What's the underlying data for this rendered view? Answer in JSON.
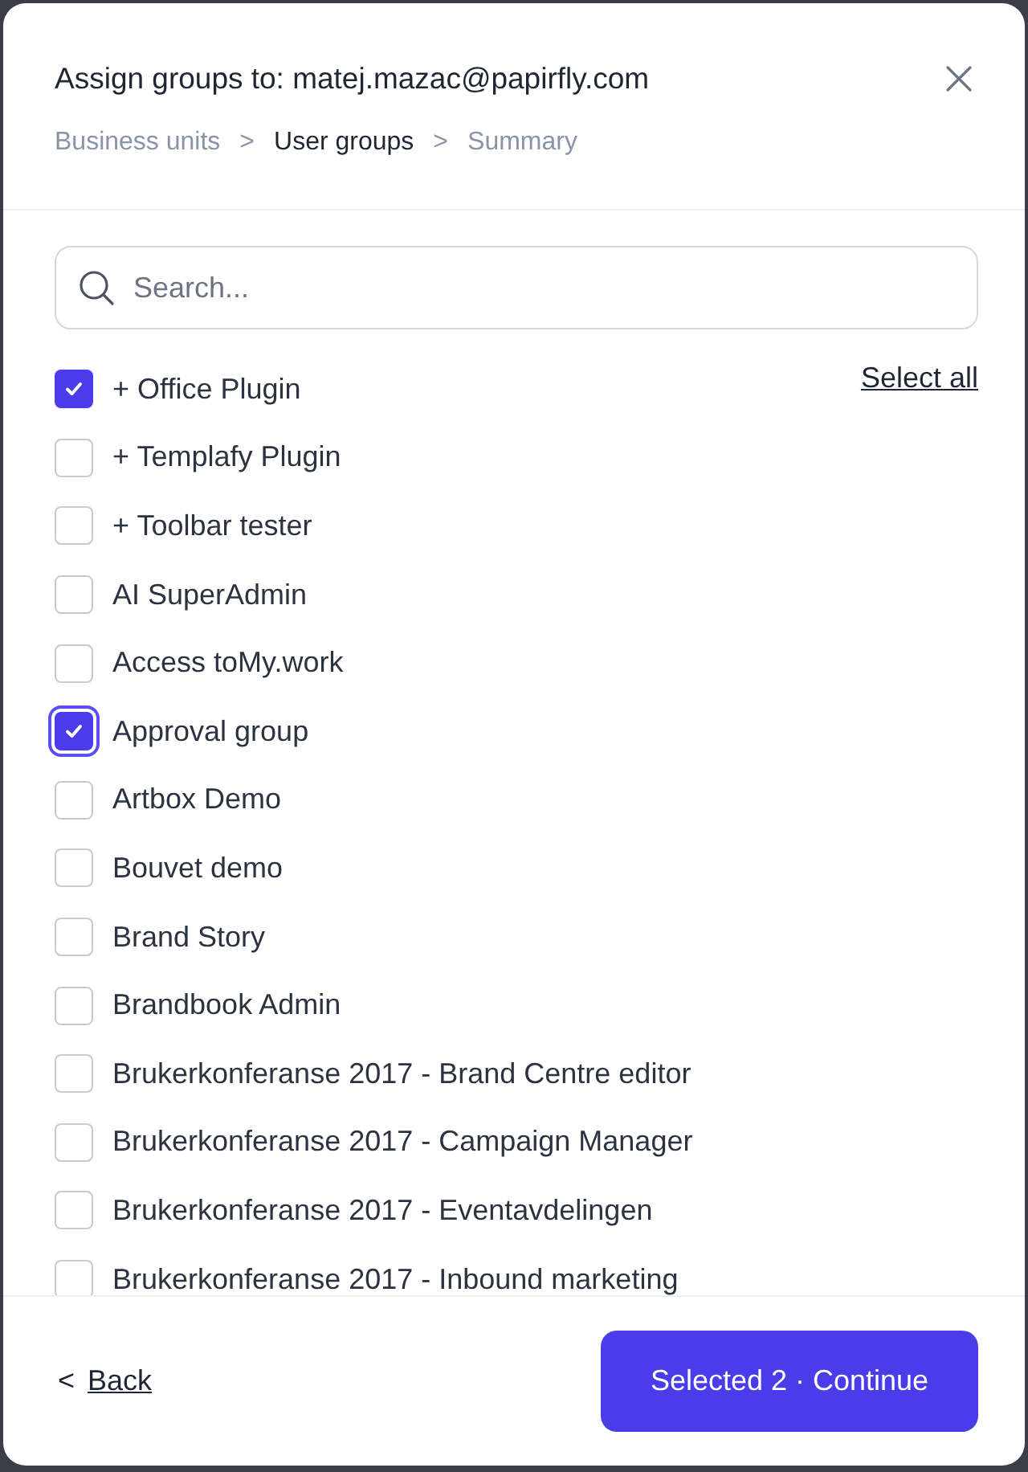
{
  "dialog": {
    "title": "Assign groups to: matej.mazac@papirfly.com",
    "breadcrumb": [
      {
        "label": "Business units",
        "selected": false
      },
      {
        "label": "User groups",
        "selected": true
      },
      {
        "label": "Summary",
        "selected": false
      }
    ],
    "breadcrumb_separator": ">",
    "search": {
      "placeholder": "Search..."
    },
    "select_all": "Select all",
    "groups": [
      {
        "label": "+ Office Plugin",
        "checked": true,
        "focused": false
      },
      {
        "label": "+ Templafy Plugin",
        "checked": false,
        "focused": false
      },
      {
        "label": "+ Toolbar tester",
        "checked": false,
        "focused": false
      },
      {
        "label": "AI SuperAdmin",
        "checked": false,
        "focused": false
      },
      {
        "label": "Access toMy.work",
        "checked": false,
        "focused": false
      },
      {
        "label": "Approval group",
        "checked": true,
        "focused": true
      },
      {
        "label": "Artbox Demo",
        "checked": false,
        "focused": false
      },
      {
        "label": "Bouvet demo",
        "checked": false,
        "focused": false
      },
      {
        "label": "Brand Story",
        "checked": false,
        "focused": false
      },
      {
        "label": "Brandbook Admin",
        "checked": false,
        "focused": false
      },
      {
        "label": "Brukerkonferanse 2017 - Brand Centre editor",
        "checked": false,
        "focused": false
      },
      {
        "label": "Brukerkonferanse 2017 - Campaign Manager",
        "checked": false,
        "focused": false
      },
      {
        "label": "Brukerkonferanse 2017 - Eventavdelingen",
        "checked": false,
        "focused": false
      },
      {
        "label": "Brukerkonferanse 2017 - Inbound marketing",
        "checked": false,
        "focused": false
      }
    ],
    "back": {
      "arrow": "<",
      "label": "Back"
    },
    "continue_button": "Selected 2 · Continue"
  }
}
